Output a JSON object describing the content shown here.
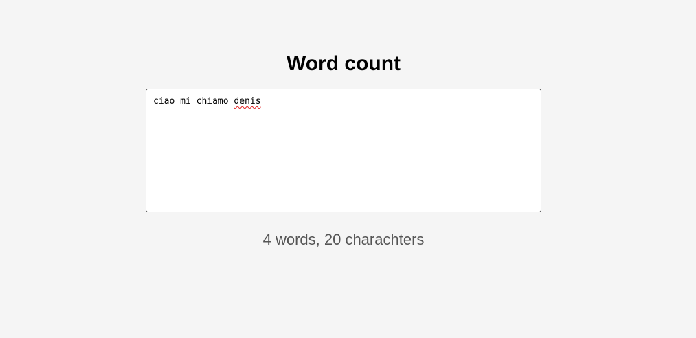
{
  "header": {
    "title": "Word count"
  },
  "editor": {
    "text_before": "ciao mi chiamo ",
    "misspelled_word": "denis"
  },
  "stats": {
    "summary": "4 words, 20 charachters"
  },
  "colors": {
    "background": "#f5f5f5",
    "spellcheck_underline": "#e02020",
    "stats_text": "#555555"
  }
}
